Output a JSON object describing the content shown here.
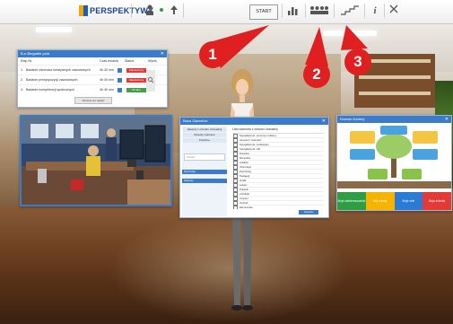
{
  "topbar": {
    "logo_text": "PERSPEKTYWY",
    "start_label": "START",
    "icons": [
      "person-icon",
      "dot-icon",
      "up-arrow-icon",
      "bar-chart-icon",
      "people-icon",
      "stairs-icon",
      "info-icon",
      "close-icon"
    ]
  },
  "job_window": {
    "title": "B-n-Biografie pola",
    "columns": [
      "Etap Nr.",
      "Czas trwania",
      "Status",
      "Wynik"
    ],
    "rows": [
      {
        "num": "1.",
        "name": "Badanie zdolności kreatywnych zawodowych",
        "time": "4h 40 min",
        "status": "Zakończony",
        "status_color": "#e53935"
      },
      {
        "num": "2.",
        "name": "Badanie predyspozycji zawodowych",
        "time": "4h 40 min",
        "status": "Zakończony",
        "status_color": "#e53935"
      },
      {
        "num": "3.",
        "name": "Badanie kompetencji społecznych",
        "time": "4h 40 min",
        "status": "W toku",
        "status_color": "#43a047"
      }
    ],
    "button_label": "Zamknij ten badań"
  },
  "list_window": {
    "title": "Baza Zawodów",
    "sidebar_items": [
      "Zawody z obszaru Uzasadnij",
      "Zawody zalecane",
      "Podobne"
    ],
    "search_placeholder": "Szukaj",
    "side_buttons": [
      "Wyszukaj",
      "Zawody"
    ],
    "list_header": "Lista zawodów z obszaru Uzasadnij",
    "items": [
      "Specjalista ds. promocji i reklamy",
      "Asystent / sekretarz",
      "Specjalista ds. marketingu",
      "Specjalista ds. HR",
      "Doradca",
      "Menedżer",
      "Analityk",
      "Informatyk",
      "Psycholog",
      "Pedagog",
      "Grafik",
      "Lekarz",
      "Prawnik",
      "Architekt",
      "Inżynier",
      "Technik",
      "Ekonomista",
      "Nauczyciel",
      "Projektant",
      "Dziennikarz"
    ],
    "ok_button": "Gotowe"
  },
  "map_window": {
    "title": "Drzewo Kariery",
    "tabs": [
      "Moje zainteresowania",
      "Mój rozwój",
      "Moje cele",
      "Moja ścieżka"
    ],
    "tab_colors": [
      "#2e9e45",
      "#f4b400",
      "#2b7bd6",
      "#e53935"
    ]
  },
  "callouts": [
    "1",
    "2",
    "3"
  ]
}
